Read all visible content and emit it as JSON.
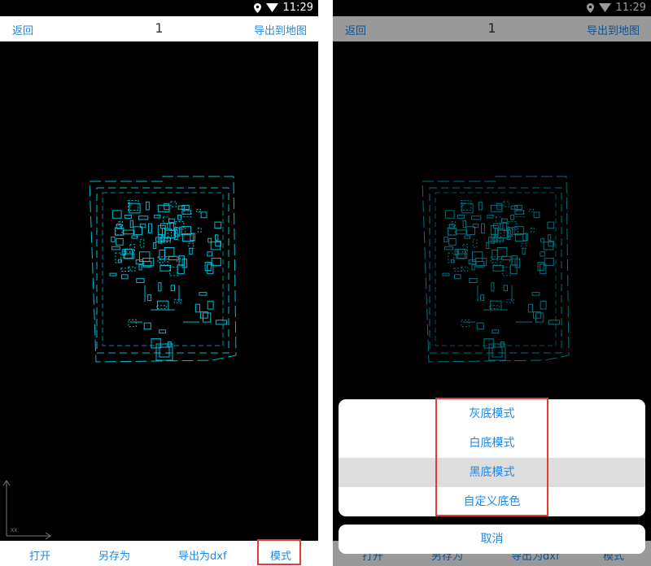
{
  "status_bar": {
    "time": "11:29",
    "icons": [
      "location-pin-icon",
      "wifi-icon"
    ]
  },
  "header": {
    "back_label": "返回",
    "title": "1",
    "export_map_label": "导出到地图"
  },
  "toolbar": {
    "open_label": "打开",
    "save_as_label": "另存为",
    "export_dxf_label": "导出为dxf",
    "mode_label": "模式"
  },
  "canvas": {
    "background": "#000000",
    "drawing_color": "#00bcd4",
    "axis_label": "XX"
  },
  "mode_sheet": {
    "options": [
      {
        "label": "灰底模式",
        "selected": false
      },
      {
        "label": "白底模式",
        "selected": false
      },
      {
        "label": "黑底模式",
        "selected": true
      },
      {
        "label": "自定义底色",
        "selected": false
      }
    ],
    "cancel_label": "取消"
  },
  "colors": {
    "accent": "#1e88e5",
    "highlight": "#e53935"
  }
}
